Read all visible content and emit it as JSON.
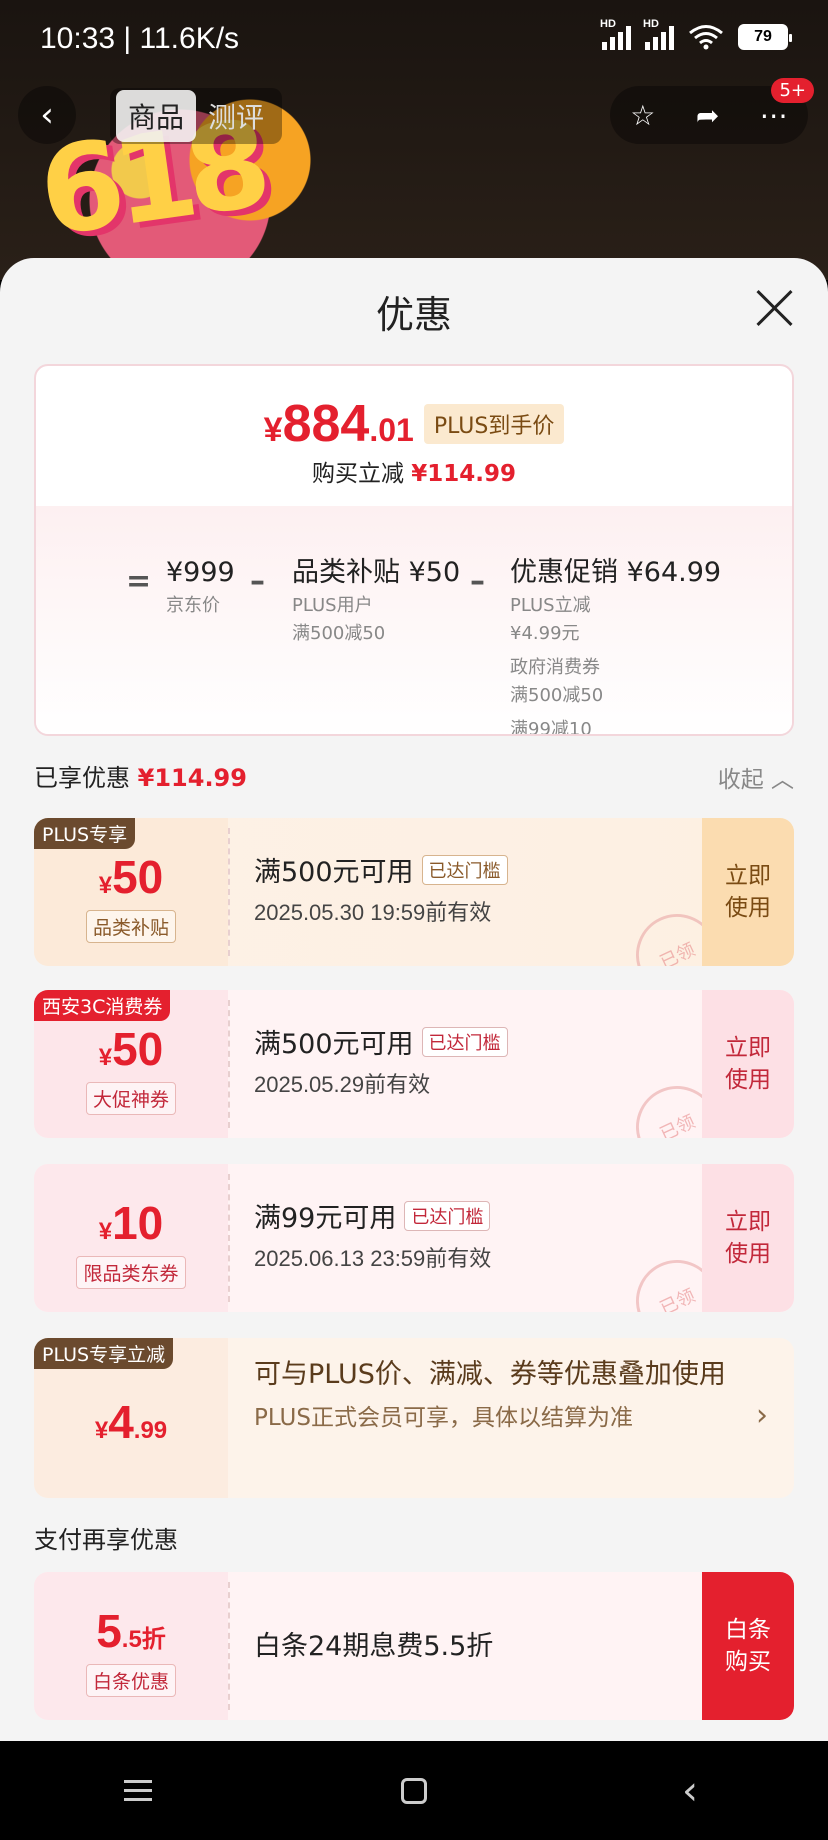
{
  "status": {
    "time": "10:33 | 11.6K/s",
    "battery": "79",
    "sim1": "HD",
    "sim2": "HD"
  },
  "nav": {
    "tabs": [
      "商品",
      "测评"
    ],
    "badge": "5+"
  },
  "sheet": {
    "title": "优惠"
  },
  "summary": {
    "final_yen": "¥",
    "final_int": "884",
    "final_dec": ".01",
    "final_tag": "PLUS到手价",
    "reduce_label": "购买立减",
    "reduce_value": "¥114.99",
    "eq": "=",
    "jd_price": "¥999",
    "jd_label": "京东价",
    "minus": "–",
    "subsidy_title": "品类补贴 ¥50",
    "subsidy_l1": "PLUS用户",
    "subsidy_l2": "满500减50",
    "promo_title": "优惠促销 ¥64.99",
    "promo_l1": "PLUS立减",
    "promo_l2": "¥4.99元",
    "promo_l3": "政府消费券",
    "promo_l4": "满500减50",
    "promo_l5": "满99减10"
  },
  "enjoyed": {
    "label": "已享优惠",
    "value": "¥114.99",
    "collapse": "收起"
  },
  "coupons": [
    {
      "tag": "PLUS专享",
      "yen": "¥",
      "amount": "50",
      "type": "品类补贴",
      "cond": "满500元可用",
      "met": "已达门槛",
      "valid": "2025.05.30 19:59前有效",
      "action_l1": "立即",
      "action_l2": "使用",
      "stamp": "已领"
    },
    {
      "tag": "西安3C消费券",
      "yen": "¥",
      "amount": "50",
      "type": "大促神券",
      "cond": "满500元可用",
      "met": "已达门槛",
      "valid": "2025.05.29前有效",
      "action_l1": "立即",
      "action_l2": "使用",
      "stamp": "已领"
    },
    {
      "yen": "¥",
      "amount": "10",
      "type": "限品类东券",
      "cond": "满99元可用",
      "met": "已达门槛",
      "valid": "2025.06.13 23:59前有效",
      "action_l1": "立即",
      "action_l2": "使用",
      "stamp": "已领"
    }
  ],
  "plus_card": {
    "tag": "PLUS专享立减",
    "yen": "¥",
    "amount": "4",
    "dec": ".99",
    "desc": "可与PLUS价、满减、券等优惠叠加使用",
    "sub": "PLUS正式会员可享，具体以结算为准"
  },
  "pay": {
    "section": "支付再享优惠",
    "amount": "5",
    "dec": ".5折",
    "type": "白条优惠",
    "desc": "白条24期息费5.5折",
    "action_l1": "白条",
    "action_l2": "购买"
  },
  "colors": {
    "accent": "#e4202e",
    "plus_brown": "#6b4a2e"
  }
}
